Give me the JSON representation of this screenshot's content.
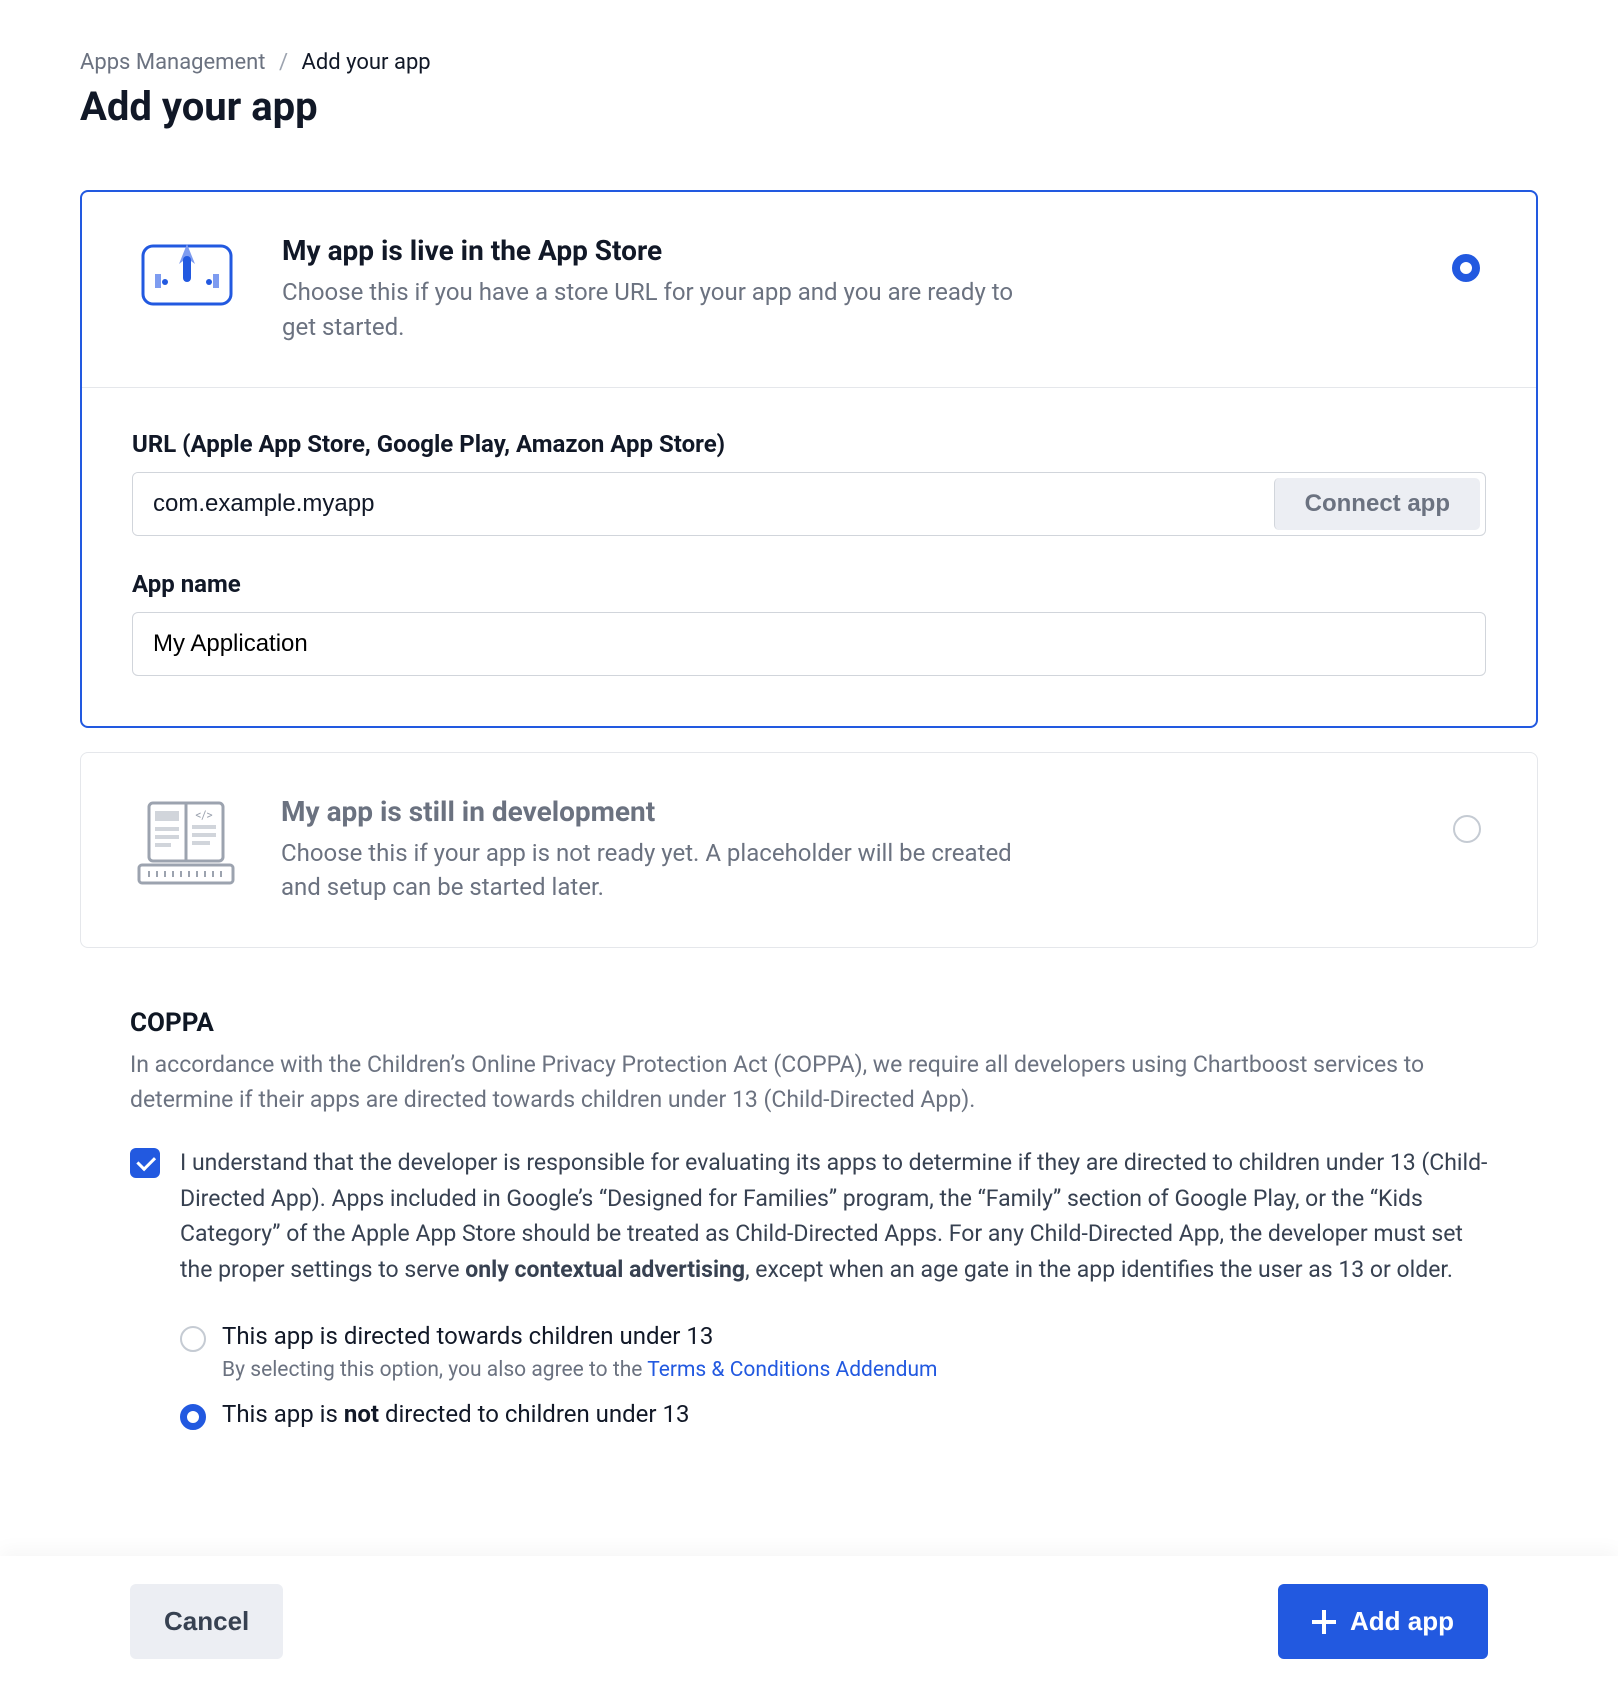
{
  "breadcrumb": {
    "parent": "Apps Management",
    "current": "Add your app"
  },
  "page_title": "Add your app",
  "options": {
    "live": {
      "title": "My app is live in the App Store",
      "desc": "Choose this if you have a store URL for your app and you are ready to get started.",
      "selected": true,
      "url_label": "URL (Apple App Store, Google Play, Amazon App Store)",
      "url_value": "com.example.myapp",
      "connect_label": "Connect app",
      "name_label": "App name",
      "name_value": "My Application"
    },
    "dev": {
      "title": "My app is still in development",
      "desc": "Choose this if your app is not ready yet. A placeholder will be created and setup can be started later.",
      "selected": false
    }
  },
  "coppa": {
    "heading": "COPPA",
    "intro": "In accordance with the Children’s Online Privacy Protection Act (COPPA), we require all developers using Chartboost services to determine if their apps are directed towards children under 13 (Child-Directed App).",
    "consent_pre": "I understand that the developer is responsible for evaluating its apps to determine if they are directed to children under 13 (Child-Directed App). Apps included in Google’s “Designed for Families” program, the “Family” section of Google Play, or the “Kids Category” of the Apple App Store should be treated as Child-Directed Apps. For any Child-Directed App, the developer must set the proper settings to serve ",
    "consent_bold": "only contextual advertising",
    "consent_post": ", except when an age gate in the app identifies the user as 13 or older.",
    "consent_checked": true,
    "radios": {
      "directed_label": "This app is directed towards children under 13",
      "directed_sub_pre": "By selecting this option, you also agree to the ",
      "directed_sub_link": "Terms & Conditions Addendum",
      "not_pre": "This app is ",
      "not_bold": "not",
      "not_post": " directed to children under 13",
      "selected": "not_directed"
    }
  },
  "footer": {
    "cancel": "Cancel",
    "add": "Add app"
  }
}
